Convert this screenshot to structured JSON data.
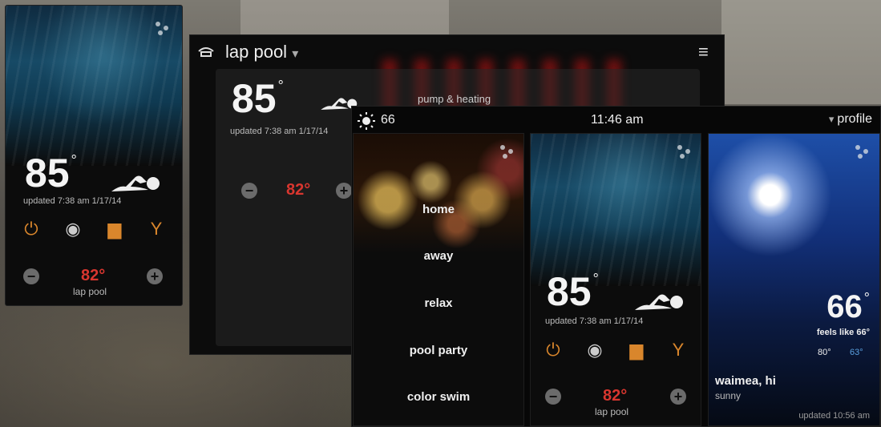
{
  "left_card": {
    "temperature": "85",
    "degree": "°",
    "updated": "updated 7:38 am 1/17/14",
    "set_temperature": "82°",
    "pool_name": "lap pool",
    "minus": "−",
    "plus": "+"
  },
  "middle_panel": {
    "title": "lap pool",
    "dropdown_glyph": "▾",
    "menu_glyph": "≡",
    "temperature": "85",
    "degree": "°",
    "updated": "updated 7:38 am 1/17/14",
    "pump_label": "pump & heating",
    "set_temperature": "82°",
    "minus": "−",
    "plus": "+"
  },
  "front_window": {
    "outside_temp": "66",
    "time": "11:46 am",
    "profile_label": "profile",
    "profile_glyph": "▾",
    "scenes": [
      "home",
      "away",
      "relax",
      "pool party",
      "color swim"
    ],
    "pool_card": {
      "temperature": "85",
      "degree": "°",
      "updated": "updated 7:38 am 1/17/14",
      "set_temperature": "82°",
      "pool_name": "lap pool",
      "minus": "−",
      "plus": "+"
    },
    "weather_card": {
      "temperature": "66",
      "degree": "°",
      "feels_like": "feels like 66°",
      "high": "80°",
      "low": "63°",
      "location": "waimea, hi",
      "condition": "sunny",
      "updated": "updated 10:56 am"
    }
  },
  "colors": {
    "accent_orange": "#d9862c",
    "set_temp_red": "#d8362f",
    "low_temp_blue": "#5aa0e0"
  }
}
